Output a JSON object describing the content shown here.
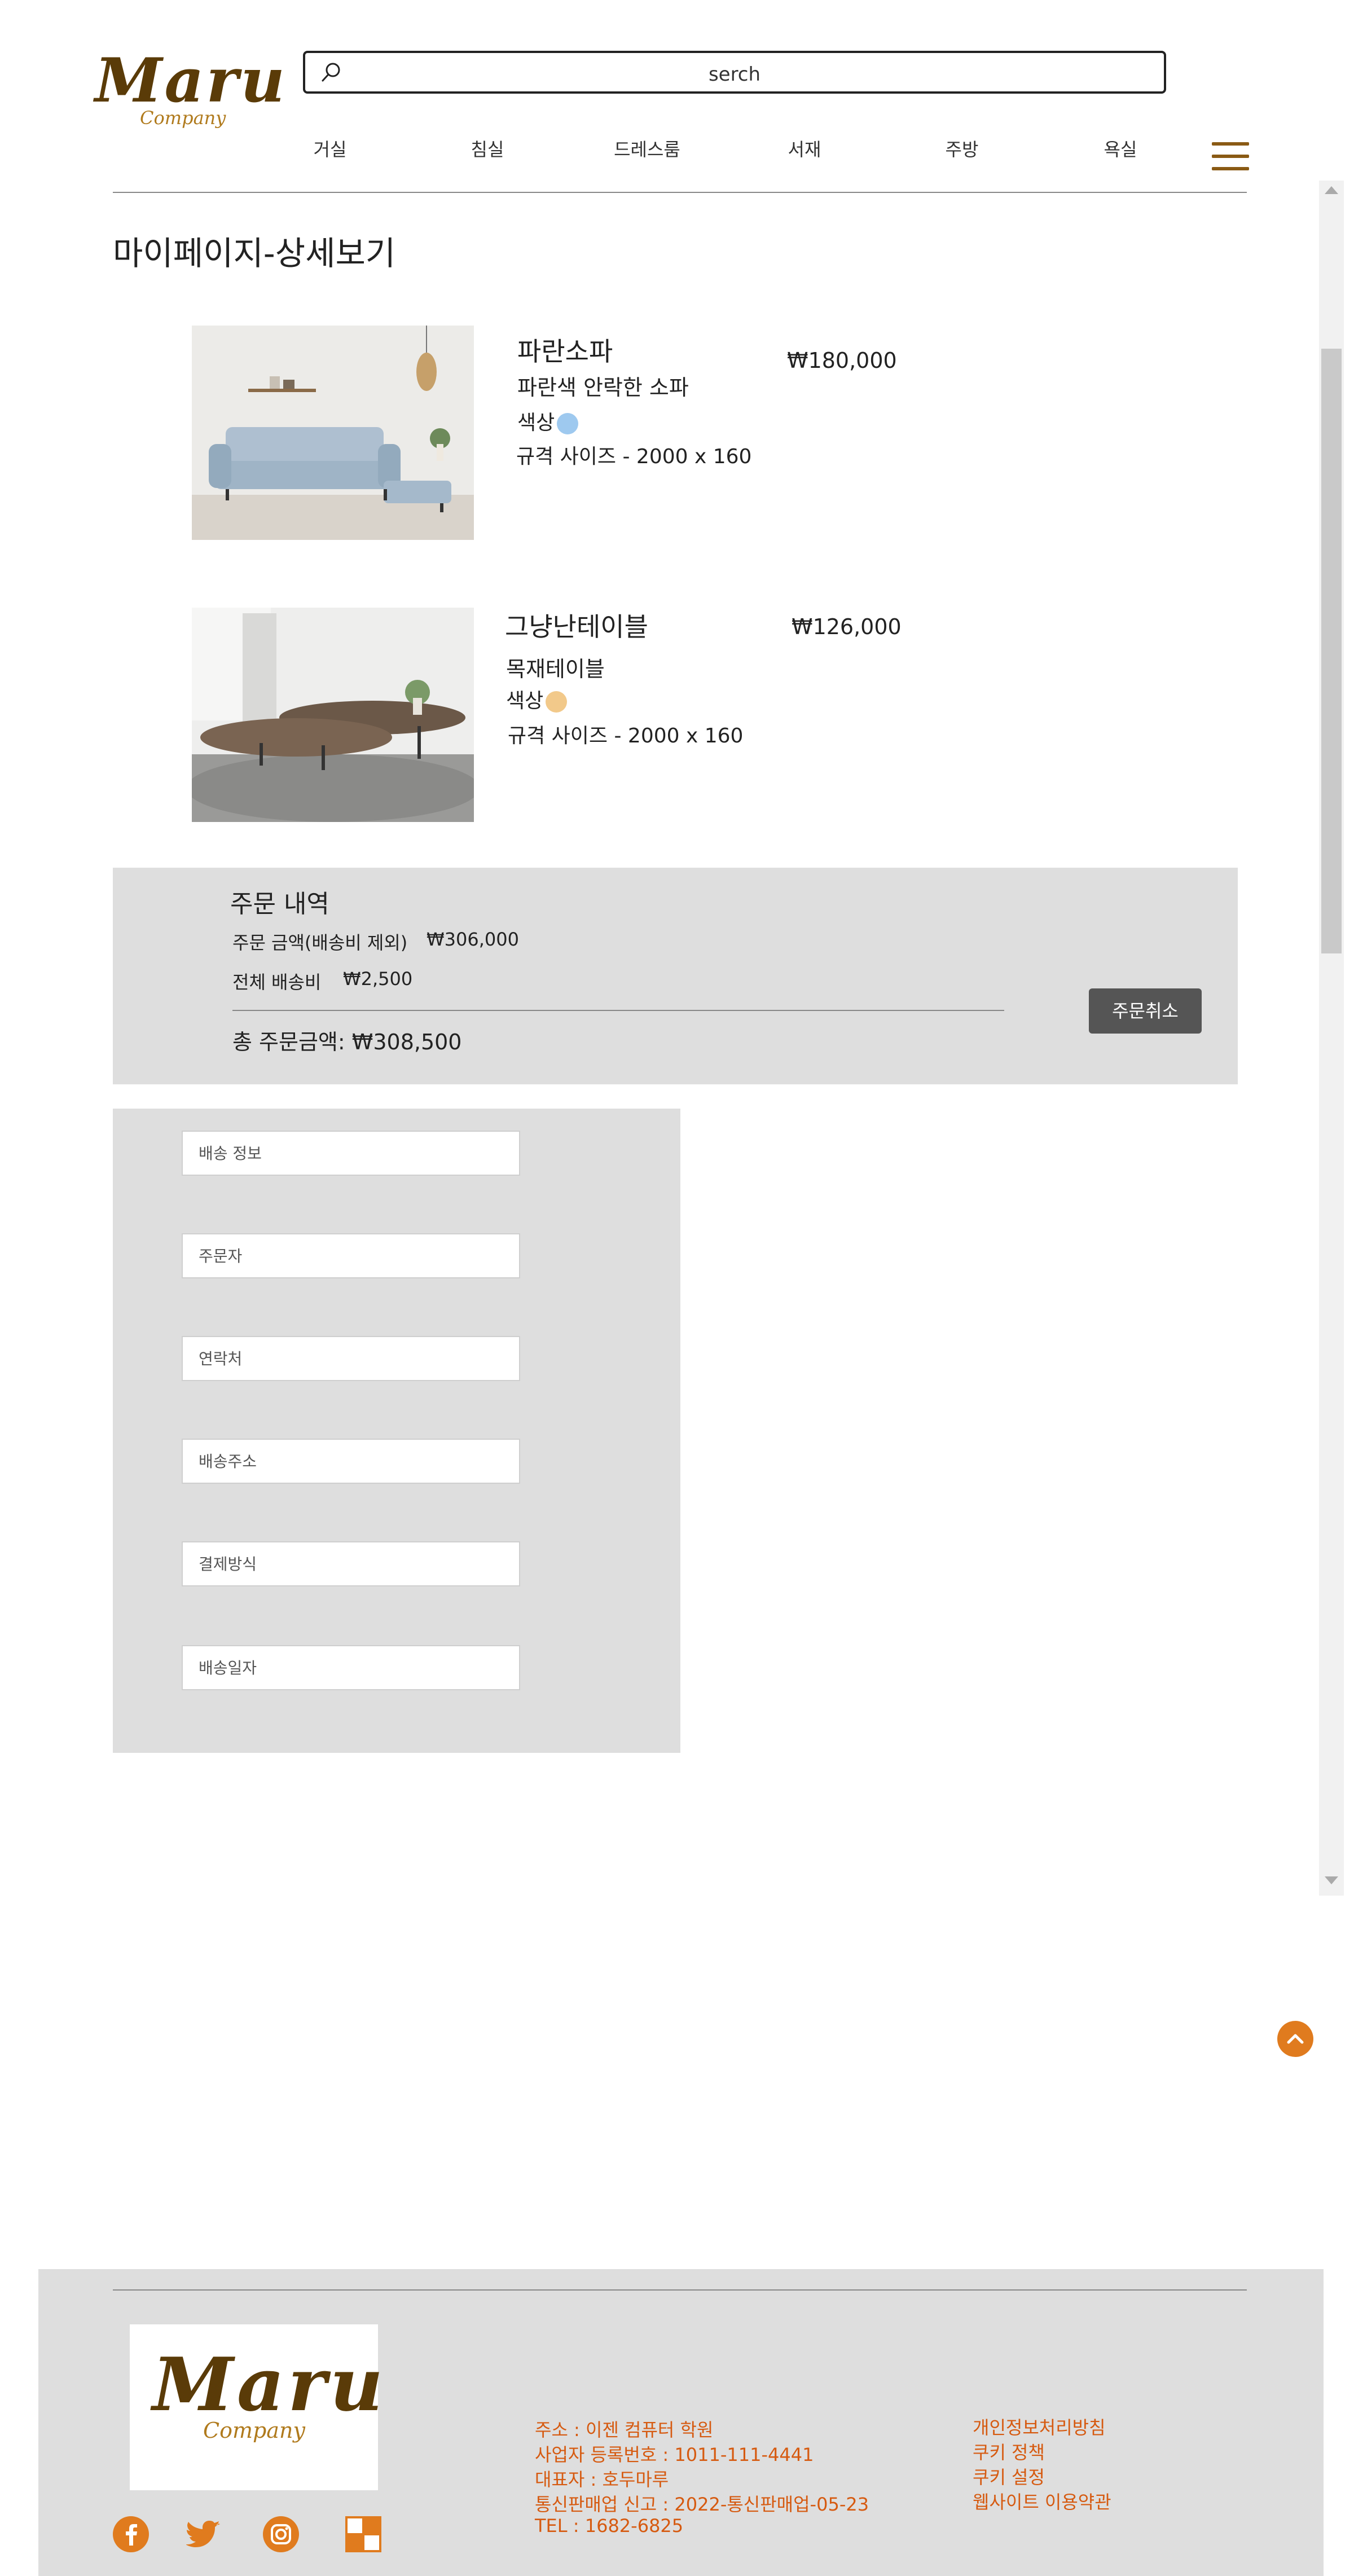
{
  "header": {
    "logo_main": "Maru",
    "logo_sub": "Company",
    "search_value": "serch",
    "nav": [
      "거실",
      "침실",
      "드레스룸",
      "서재",
      "주방",
      "욕실"
    ]
  },
  "page_title": "마이페이지-상세보기",
  "products": [
    {
      "name": "파란소파",
      "desc": "파란색 안락한 소파",
      "color_label": "색상",
      "color_hex": "#9ec9ef",
      "size": "규격 사이즈 - 2000 x 160",
      "price": "₩180,000"
    },
    {
      "name": "그냥난테이블",
      "desc": "목재테이블",
      "color_label": "색상",
      "color_hex": "#f2c98a",
      "size": "규격 사이즈 - 2000 x 160",
      "price": "₩126,000"
    }
  ],
  "summary": {
    "title": "주문 내역",
    "subtotal_label": "주문 금액(배송비 제외)",
    "subtotal_value": "₩306,000",
    "shipping_label": "전체 배송비",
    "shipping_value": "₩2,500",
    "total_text": "총 주문금액: ₩308,500",
    "cancel_label": "주문취소"
  },
  "form": {
    "fields": [
      "배송 정보",
      "주문자",
      "연락처",
      "배송주소",
      "결제방식",
      "배송일자"
    ]
  },
  "footer": {
    "logo_main": "Maru",
    "logo_sub": "Company",
    "address": "주소 : 이젠 컴퓨터 학원",
    "business_no": "사업자 등록번호 : 1011-111-4441",
    "ceo": "대표자 : 호두마루",
    "ecommerce": "통신판매업 신고 : 2022-통신판매업-05-23",
    "tel": "TEL : 1682-6825",
    "links": [
      "개인정보처리방침",
      "쿠키 정책",
      "쿠키 설정",
      "웹사이트 이용약관"
    ]
  },
  "colors": {
    "accent": "#e07b1e",
    "footer_text": "#d65a10",
    "panel": "#dedede",
    "logo": "#5a3b08"
  },
  "icons": [
    "search-icon",
    "hamburger-menu-icon",
    "scroll-top-icon",
    "facebook-icon",
    "twitter-icon",
    "instagram-icon",
    "checker-icon"
  ]
}
